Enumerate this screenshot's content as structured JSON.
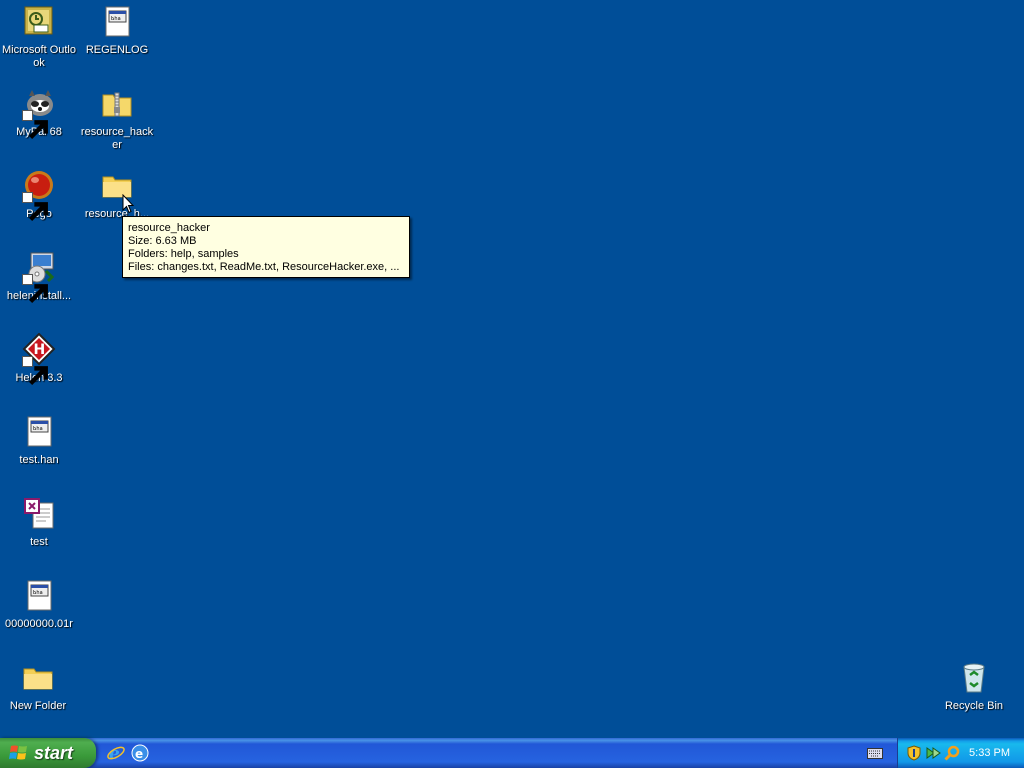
{
  "desktop": {
    "background_color": "#004e98",
    "icons": [
      {
        "label": "Microsoft Outlook",
        "icon": "outlook-icon"
      },
      {
        "label": "REGENLOG",
        "icon": "document-icon"
      },
      {
        "label": "MyPal 68",
        "icon": "raccoon-icon"
      },
      {
        "label": "resource_hacker",
        "icon": "zip-folder-icon"
      },
      {
        "label": "Pego",
        "icon": "red-ball-icon"
      },
      {
        "label": "resource_h...",
        "icon": "folder-icon"
      },
      {
        "label": "heleninstall...",
        "icon": "installer-icon"
      },
      {
        "label": "Helen 3.3",
        "icon": "helen-icon"
      },
      {
        "label": "test.han",
        "icon": "document-icon"
      },
      {
        "label": "test",
        "icon": "han-file-icon"
      },
      {
        "label": "00000000.01r",
        "icon": "document-icon"
      },
      {
        "label": "New Folder",
        "icon": "folder-icon"
      },
      {
        "label": "Recycle Bin",
        "icon": "recycle-bin-icon"
      }
    ]
  },
  "tooltip": {
    "title": "resource_hacker",
    "size": "Size: 6.63 MB",
    "folders": "Folders: help, samples",
    "files": "Files: changes.txt, ReadMe.txt, ResourceHacker.exe, ..."
  },
  "taskbar": {
    "start_label": "start",
    "quick_launch": [
      "internet-explorer-icon",
      "outlook-express-icon"
    ],
    "tray_icons": [
      "security-shield-icon",
      "network-icon",
      "search-icon"
    ],
    "clock": "5:33 PM"
  }
}
